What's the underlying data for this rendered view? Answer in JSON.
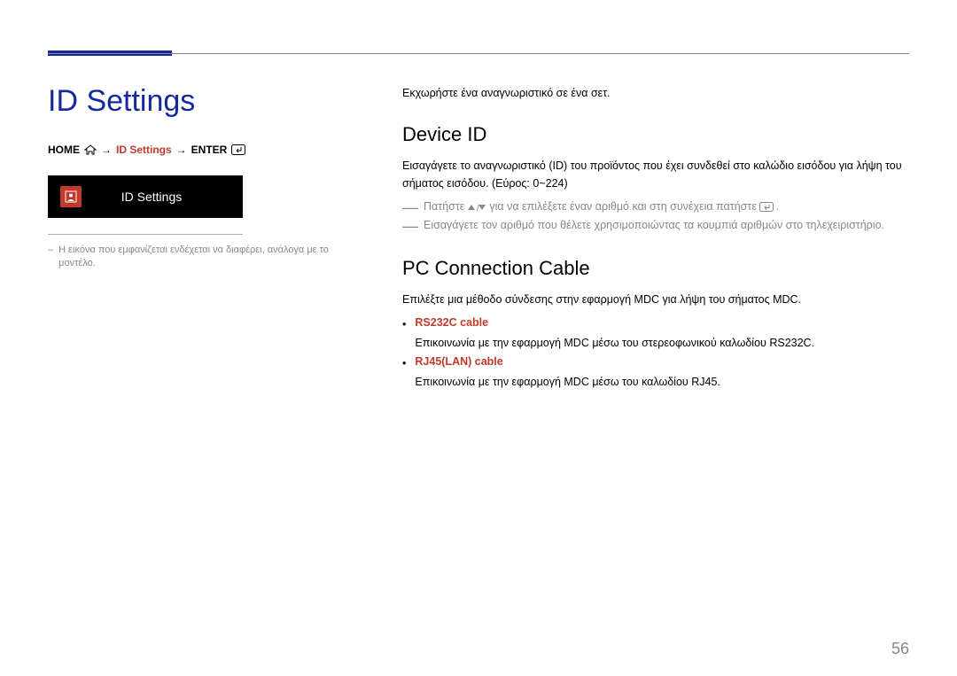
{
  "left": {
    "title": "ID Settings",
    "breadcrumb": {
      "home": "HOME",
      "arrow": "→",
      "mid": "ID Settings",
      "enter": "ENTER"
    },
    "tile_label": "ID Settings",
    "note_dash": "–",
    "note": "Η εικόνα που εμφανίζεται ενδέχεται να διαφέρει, ανάλογα με το μοντέλο."
  },
  "right": {
    "intro": "Εκχωρήστε ένα αναγνωριστικό σε ένα σετ.",
    "device_id": {
      "heading": "Device ID",
      "body": "Εισαγάγετε το αναγνωριστικό (ID) του προϊόντος που έχει συνδεθεί στο καλώδιο εισόδου για λήψη του σήματος εισόδου. (Εύρος: 0~224)",
      "dash1a": "Πατήστε",
      "dash1b": "για να επιλέξετε έναν αριθμό και στη συνέχεια πατήστε",
      "dash1c": ".",
      "dash2": "Εισαγάγετε τον αριθμό που θέλετε χρησιμοποιώντας τα κουμπιά αριθμών στο τηλεχειριστήριο."
    },
    "pc_cable": {
      "heading": "PC Connection Cable",
      "body": "Επιλέξτε μια μέθοδο σύνδεσης στην εφαρμογή MDC για λήψη του σήματος MDC.",
      "item1_label": "RS232C cable",
      "item1_body": "Επικοινωνία με την εφαρμογή MDC μέσω του στερεοφωνικού καλωδίου RS232C.",
      "item2_label": "RJ45(LAN) cable",
      "item2_body": "Επικοινωνία με την εφαρμογή MDC μέσω του καλωδίου RJ45."
    }
  },
  "page_number": "56"
}
